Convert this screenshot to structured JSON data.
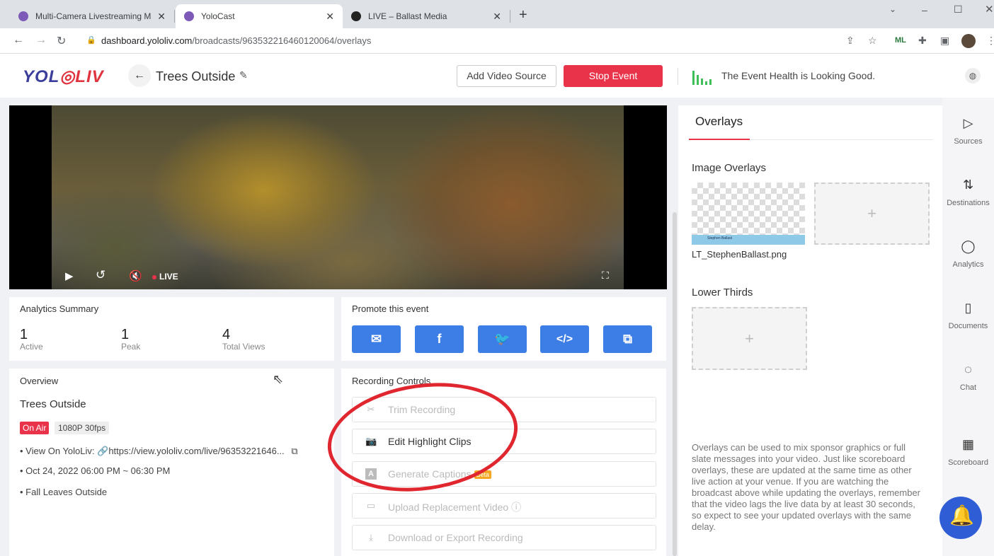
{
  "browser": {
    "tabs": [
      {
        "title": "Multi-Camera Livestreaming Mac",
        "favicon_color": "#7d5ab8"
      },
      {
        "title": "YoloCast",
        "favicon_color": "#7d5ab8"
      },
      {
        "title": "LIVE – Ballast Media",
        "favicon_color": "#222222"
      }
    ],
    "new_tab": "+",
    "url_host": "dashboard.yololiv.com",
    "url_path": "/broadcasts/963532216460120064/overlays",
    "ext_ml": "ML"
  },
  "header": {
    "logo_yol": "YOL",
    "logo_o": "◎",
    "logo_liv": "LIV",
    "event_title": "Trees Outside",
    "add_video_source": "Add Video Source",
    "stop_event": "Stop Event",
    "health_text": "The Event Health is Looking Good.",
    "health_color": "#3fbf5a"
  },
  "video": {
    "live_label": "LIVE"
  },
  "analytics": {
    "title": "Analytics Summary",
    "stats": [
      {
        "value": "1",
        "label": "Active"
      },
      {
        "value": "1",
        "label": "Peak"
      },
      {
        "value": "4",
        "label": "Total Views"
      }
    ]
  },
  "promote": {
    "title": "Promote this event",
    "icons": [
      "mail-icon",
      "facebook-icon",
      "twitter-icon",
      "embed-code-icon",
      "copy-icon"
    ]
  },
  "overview": {
    "title": "Overview",
    "event_name": "Trees Outside",
    "status_badge": "On Air",
    "resolution_badge": "1080P 30fps",
    "view_on_label": "View On YoloLiv:",
    "view_link": "https://view.yololiv.com/live/96353221646...",
    "schedule": "Oct 24, 2022 06:00 PM ~ 06:30 PM",
    "description": "Fall Leaves Outside"
  },
  "recording": {
    "title": "Recording Controls",
    "items": [
      {
        "label": "Trim Recording",
        "enabled": false
      },
      {
        "label": "Edit Highlight Clips",
        "enabled": true
      },
      {
        "label": "Generate Captions",
        "enabled": false,
        "badge": "Beta"
      },
      {
        "label": "Upload Replacement Video",
        "enabled": false
      },
      {
        "label": "Download or Export Recording",
        "enabled": false
      }
    ]
  },
  "overlays": {
    "tab": "Overlays",
    "image_overlays_label": "Image Overlays",
    "image_file": "LT_StephenBallast.png",
    "thumb_text": "Stephen Ballast",
    "lower_thirds_label": "Lower Thirds",
    "add_symbol": "+",
    "description": "Overlays can be used to mix sponsor graphics or full slate messages into your video. Just like scoreboard overlays, these are updated at the same time as other live action at your venue. If you are watching the broadcast above while updating the overlays, remember that the video lags the live data by at least 30 seconds, so expect to see your updated overlays with the same delay."
  },
  "rail": [
    {
      "label": "Sources",
      "icon": "sources-icon"
    },
    {
      "label": "Destinations",
      "icon": "destinations-icon"
    },
    {
      "label": "Analytics",
      "icon": "analytics-icon"
    },
    {
      "label": "Documents",
      "icon": "documents-icon"
    },
    {
      "label": "Chat",
      "icon": "chat-icon"
    },
    {
      "label": "Scoreboard",
      "icon": "scoreboard-icon"
    }
  ],
  "colors": {
    "accent_red": "#e8334a",
    "promo_blue": "#3d7ee6",
    "annotation_red": "#e0262f"
  }
}
